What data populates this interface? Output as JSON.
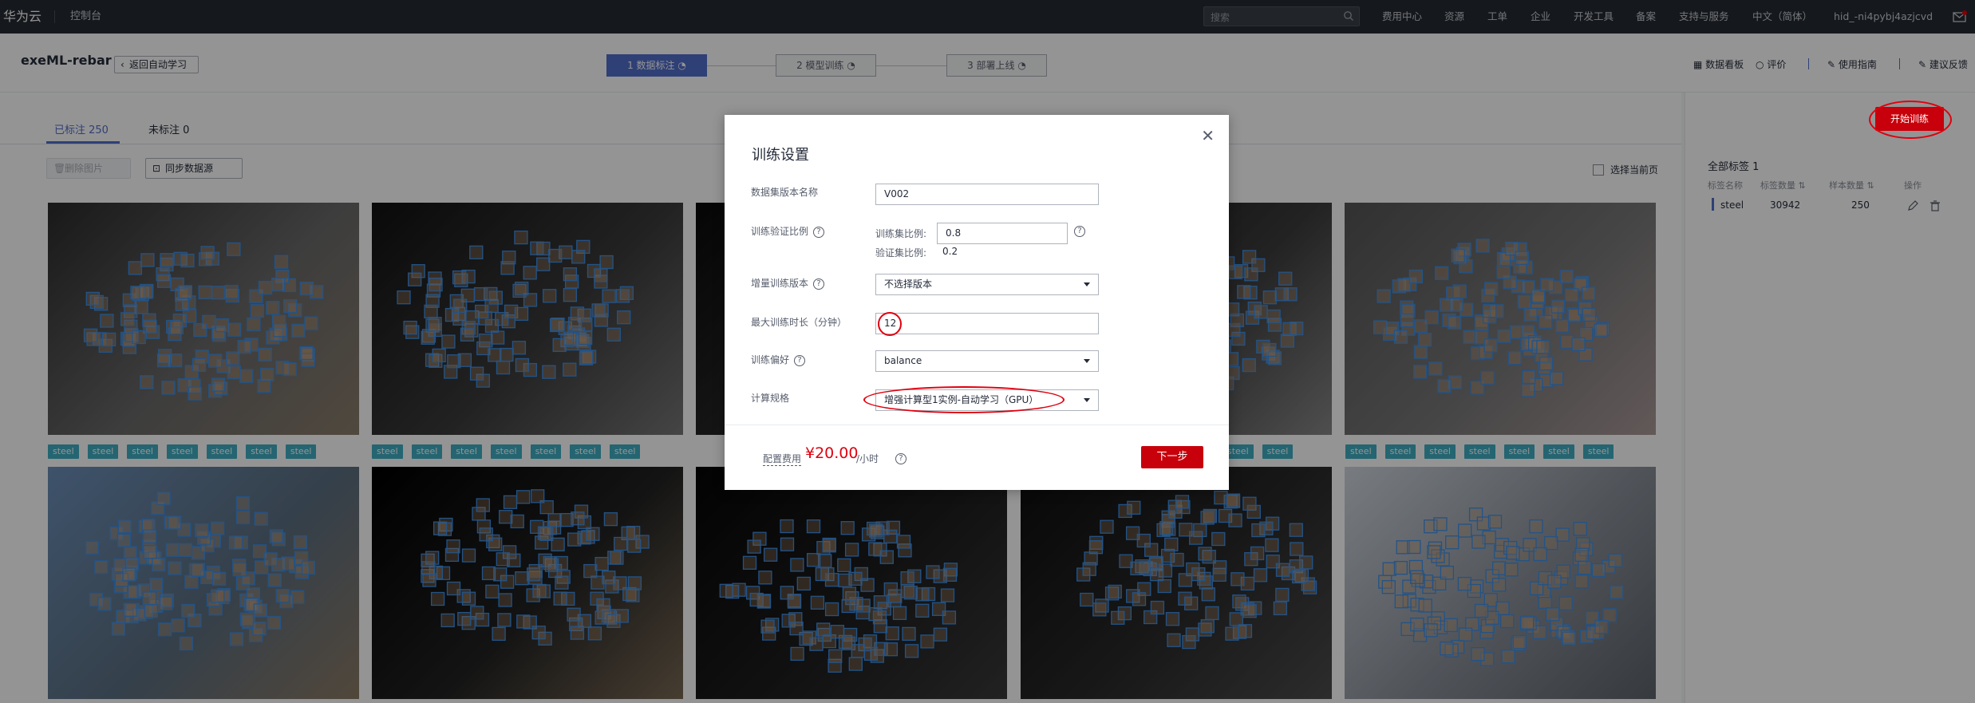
{
  "topbar": {
    "logo": "华为云",
    "console": "控制台",
    "search_placeholder": "搜索",
    "nav": [
      "费用中心",
      "资源",
      "工单",
      "企业",
      "开发工具",
      "备案",
      "支持与服务",
      "中文（简体）",
      "hid_-ni4pybj4azjcvd"
    ]
  },
  "subbar": {
    "project_name": "exeML-rebar",
    "back_label": "返回自动学习",
    "steps": [
      "1 数据标注",
      "2 模型训练",
      "3 部署上线"
    ],
    "tools": [
      "数据看板",
      "评价",
      "使用指南",
      "建议反馈"
    ]
  },
  "tabs": {
    "labeled": "已标注 250",
    "unlabeled": "未标注 0"
  },
  "actions": {
    "delete_images": "删除图片",
    "sync_source": "同步数据源",
    "select_page": "选择当前页",
    "start_training": "开始训练"
  },
  "gallery": {
    "tag_name": "steel",
    "rows": [
      {
        "tags": [
          "steel",
          "steel",
          "steel",
          "steel",
          "steel",
          "steel",
          "steel"
        ]
      },
      {
        "tags": [
          "steel",
          "steel",
          "steel",
          "steel",
          "steel",
          "steel",
          "steel"
        ]
      },
      {
        "tags": [
          "steel",
          "steel"
        ]
      },
      {
        "tags": [
          "steel",
          "steel",
          "steel",
          "steel",
          "steel",
          "steel",
          "steel"
        ]
      }
    ]
  },
  "label_panel": {
    "title": "全部标签",
    "count": "1",
    "headers": [
      "标签名称",
      "标签数量",
      "样本数量",
      "操作"
    ],
    "rows": [
      {
        "name": "steel",
        "label_count": "30942",
        "sample_count": "250"
      }
    ]
  },
  "modal": {
    "title": "训练设置",
    "fields": {
      "version_name_label": "数据集版本名称",
      "version_name_value": "V002",
      "split_label": "训练验证比例",
      "train_ratio_label": "训练集比例:",
      "train_ratio_value": "0.8",
      "val_ratio_label": "验证集比例:",
      "val_ratio_value": "0.2",
      "incremental_label": "增量训练版本",
      "incremental_value": "不选择版本",
      "max_duration_label": "最大训练时长（分钟）",
      "max_duration_value": "12",
      "preference_label": "训练偏好",
      "preference_value": "balance",
      "spec_label": "计算规格",
      "spec_value": "增强计算型1实例-自动学习（GPU）"
    },
    "footer": {
      "fee_label": "配置费用",
      "price": "¥20.00",
      "unit": "/小时",
      "next_button": "下一步"
    }
  },
  "colors": {
    "accent": "#526ecc",
    "danger": "#c7000b",
    "tag": "#3eaec3",
    "topbar": "#252a31"
  }
}
